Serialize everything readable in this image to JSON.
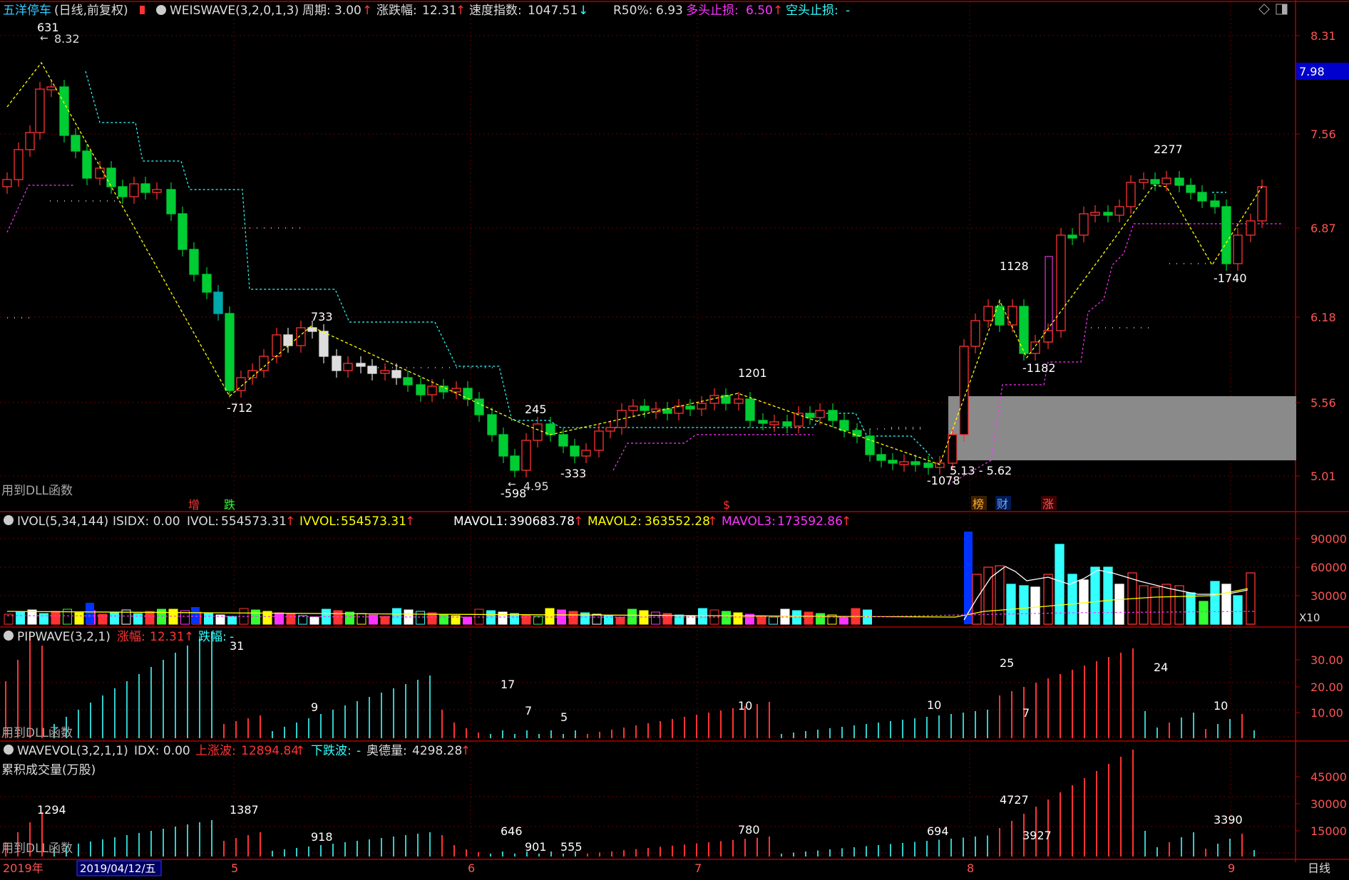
{
  "header": {
    "stock_name": "五洋停车",
    "period_info": "(日线,前复权)",
    "indicator": "WEISWAVE(3,2,0,1,3)",
    "period_label": "周期:",
    "period_value": "3.00",
    "change_label": "涨跌幅:",
    "change_value": "12.31",
    "speed_label": "速度指数:",
    "speed_value": "1047.51",
    "r50_label": "R50%:",
    "r50_value": "6.93",
    "long_stop_label": "多头止损:",
    "long_stop_value": "6.50",
    "short_stop_label": "空头止损:",
    "short_stop_value": "-"
  },
  "dll_label": "用到DLL函数",
  "price_axis": {
    "ticks": [
      "8.31",
      "7.56",
      "6.87",
      "6.18",
      "5.56",
      "5.01"
    ],
    "current_price": "7.98"
  },
  "price_annotations": {
    "peak_count": "631",
    "peak_price": "8.32",
    "low_712": "-712",
    "wave_733": "733",
    "wave_245": "245",
    "low_598": "-598",
    "low_price_495": "4.95",
    "low_333": "-333",
    "wave_1201": "1201",
    "low_1078": "-1078",
    "range_label": "5.13 - 5.62",
    "wave_1128": "1128",
    "low_1182": "-1182",
    "wave_2277": "2277",
    "low_1740": "-1740"
  },
  "event_markers": {
    "zeng": "增",
    "die": "跌",
    "dollar": "$",
    "bang": "榜",
    "cai": "财",
    "zhang": "涨"
  },
  "ivol_panel": {
    "title": "IVOL(5,34,144)",
    "isidx": "ISIDX: 0.00",
    "ivol_label": "IVOL:",
    "ivol_value": "554573.31",
    "ivvol_label": "IVVOL:",
    "ivvol_value": "554573.31",
    "mavol1_label": "MAVOL1:",
    "mavol1_value": "390683.78",
    "mavol2_label": "MAVOL2:",
    "mavol2_value": "363552.28",
    "mavol3_label": "MAVOL3:",
    "mavol3_value": "173592.86",
    "ticks": [
      "90000",
      "60000",
      "30000"
    ],
    "unit": "X10"
  },
  "pipwave_panel": {
    "title": "PIPWAVE(3,2,1)",
    "rise_label": "涨幅:",
    "rise_value": "12.31",
    "fall_label": "跌幅:",
    "fall_value": "-",
    "ticks": [
      "30.00",
      "20.00",
      "10.00"
    ],
    "labels": [
      "31",
      "9",
      "17",
      "7",
      "5",
      "10",
      "10",
      "25",
      "7",
      "24",
      "10"
    ]
  },
  "wavevol_panel": {
    "title": "WAVEVOL(3,2,1,1)",
    "idx": "IDX: 0.00",
    "up_label": "上涨波:",
    "up_value": "12894.84",
    "down_label": "下跌波:",
    "down_value": "-",
    "ode_label": "奥德量:",
    "ode_value": "4298.28",
    "subtitle": "累积成交量(万股)",
    "ticks": [
      "45000",
      "30000",
      "15000"
    ],
    "labels": [
      "1294",
      "1387",
      "918",
      "646",
      "901",
      "555",
      "780",
      "694",
      "4727",
      "3927",
      "3390"
    ]
  },
  "time_axis": {
    "year": "2019年",
    "cursor_date": "2019/04/12/五",
    "months": [
      "5",
      "6",
      "7",
      "8",
      "9"
    ],
    "period": "日线"
  },
  "colors": {
    "up": "#ff3333",
    "down": "#00cc33",
    "cyan": "#33ffff",
    "yellow": "#ffff00",
    "magenta": "#ff33ff",
    "axis": "#b00000",
    "text_red": "#ff3333"
  }
}
